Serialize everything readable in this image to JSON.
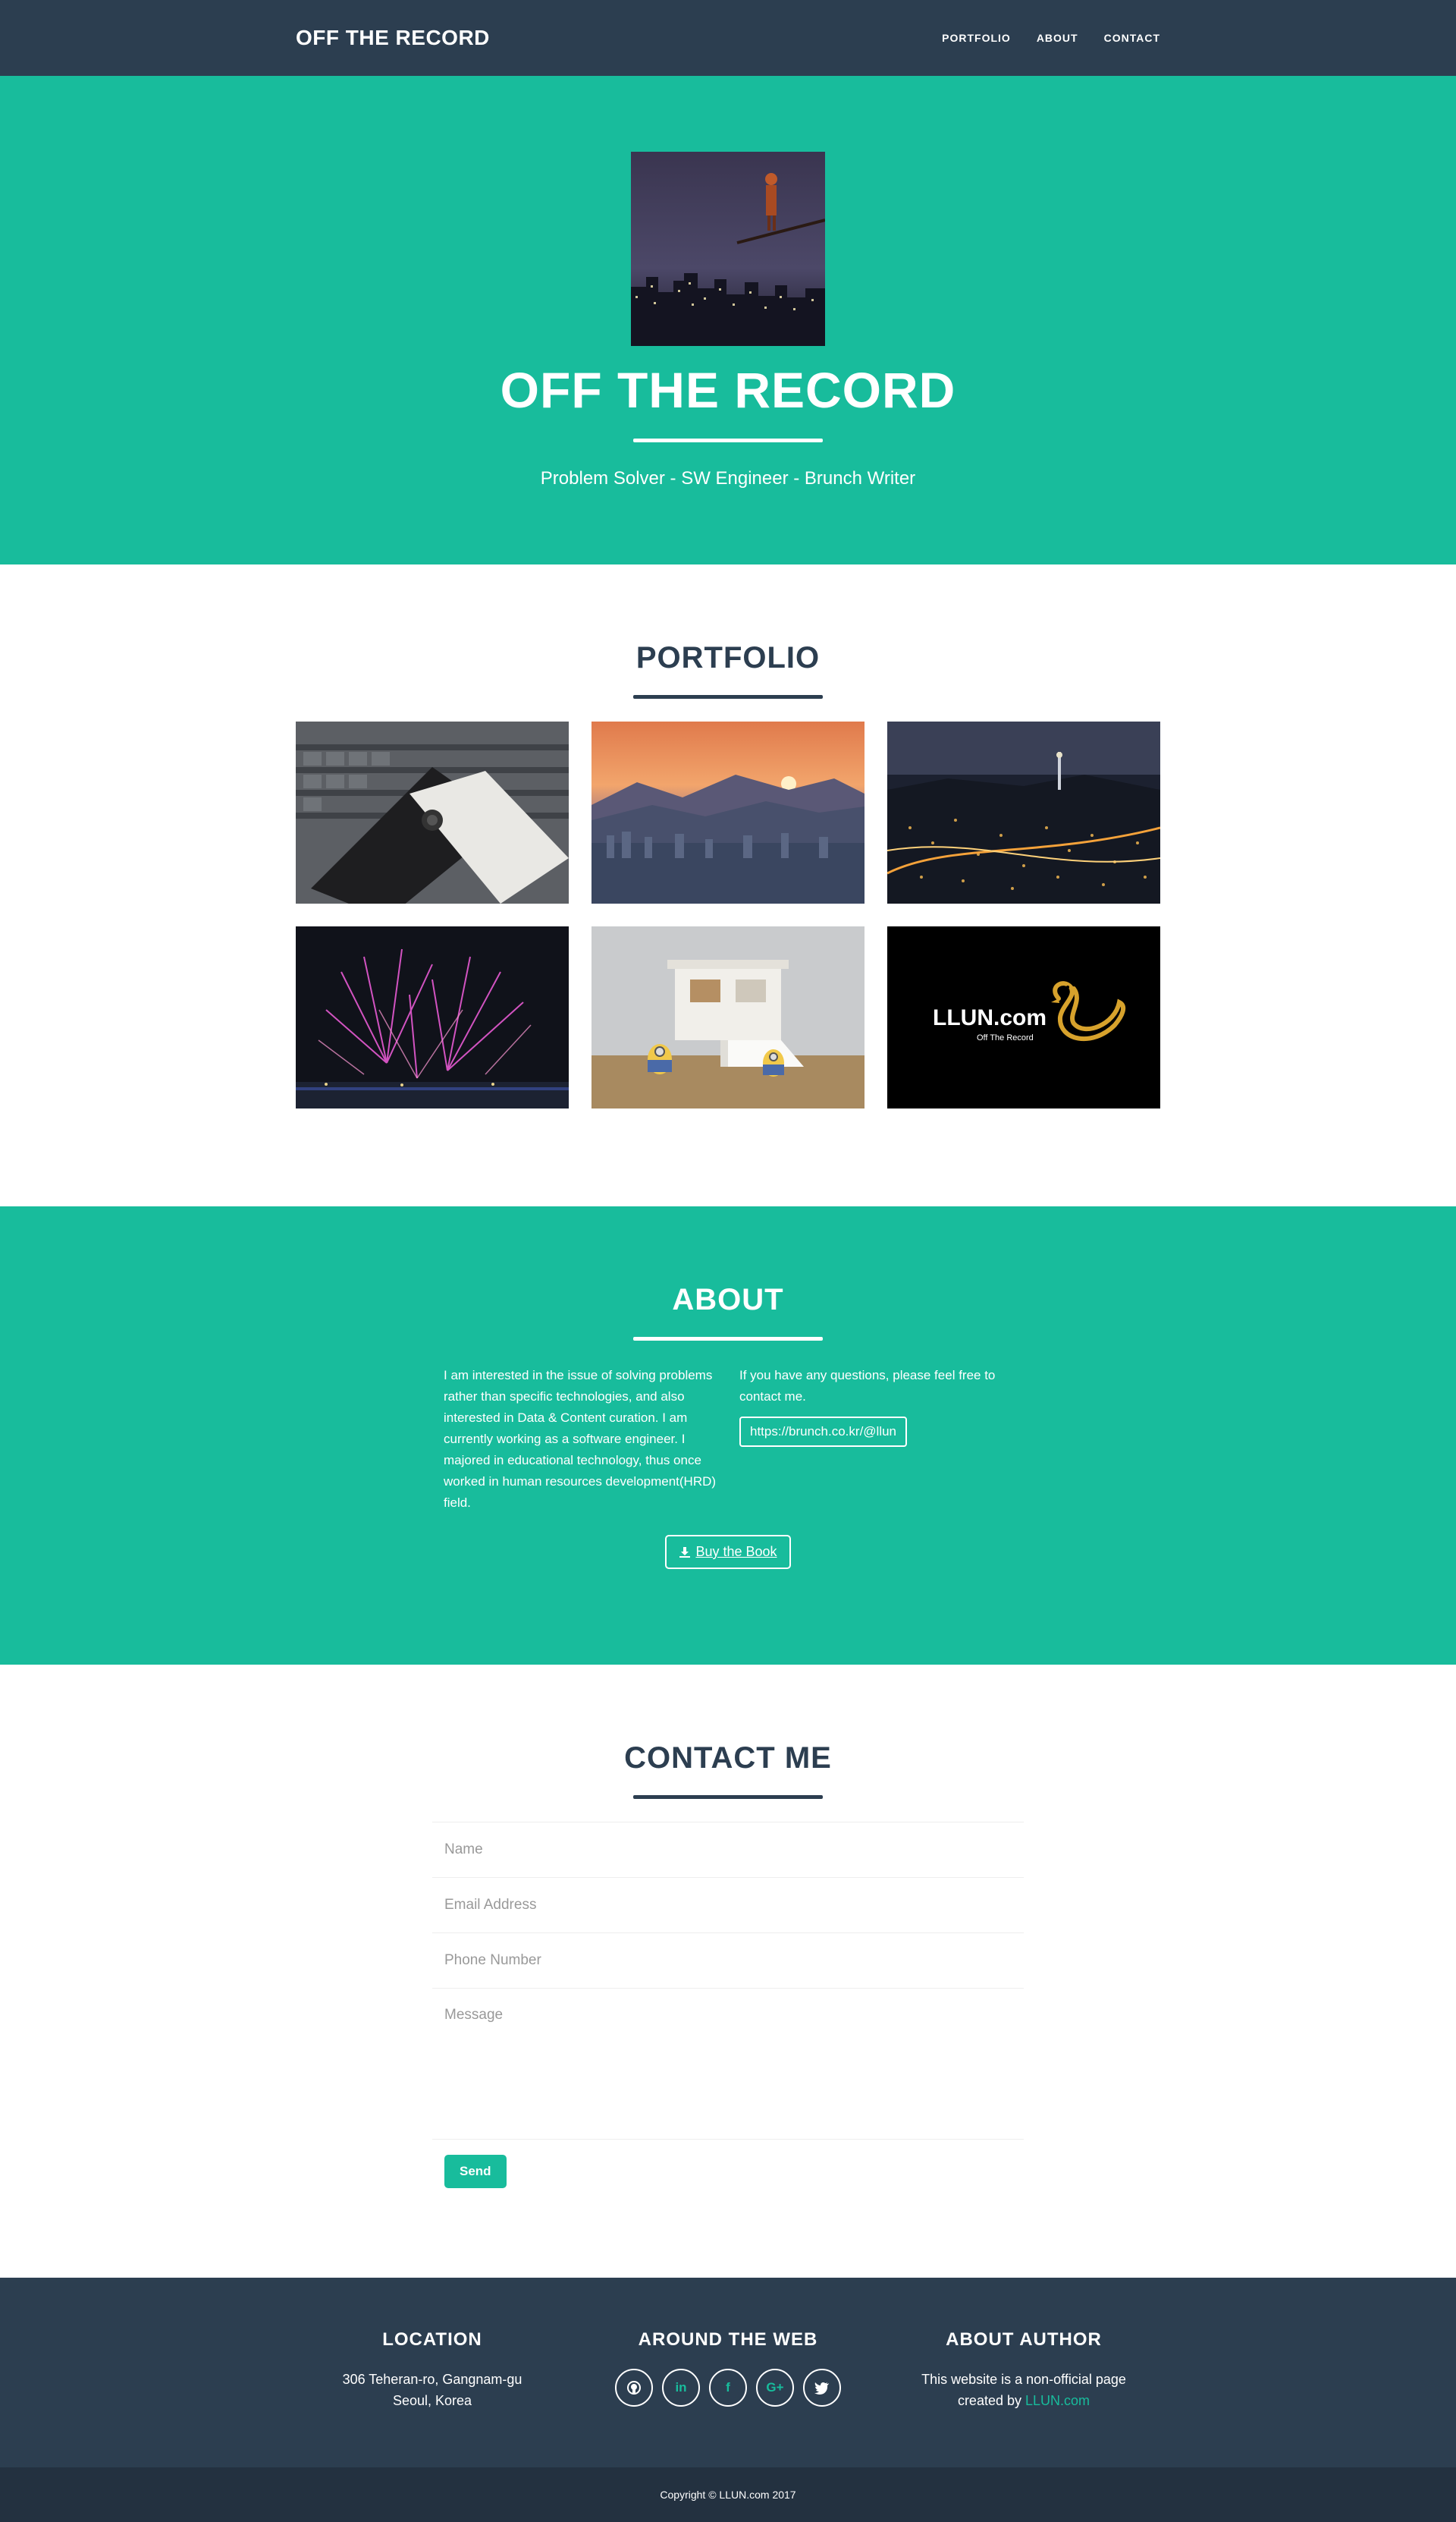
{
  "nav": {
    "brand": "OFF THE RECORD",
    "links": [
      "PORTFOLIO",
      "ABOUT",
      "CONTACT"
    ]
  },
  "hero": {
    "title": "OFF THE RECORD",
    "subtitle": "Problem Solver - SW Engineer - Brunch Writer"
  },
  "portfolio": {
    "title": "PORTFOLIO",
    "tiles": [
      {
        "icon": "smartphones-photo"
      },
      {
        "icon": "mountain-sunset-photo"
      },
      {
        "icon": "city-night-photo"
      },
      {
        "icon": "fireworks-photo"
      },
      {
        "icon": "model-house-photo"
      },
      {
        "icon": "llun-logo",
        "logo_text": "LLUN.com",
        "logo_sub": "Off The Record"
      }
    ]
  },
  "about": {
    "title": "ABOUT",
    "left_text": "I am interested in the issue of solving problems rather than specific technologies, and also interested in Data & Content curation. I am currently working as a software engineer. I majored in educational technology, thus once worked in human resources development(HRD) field.",
    "right_text": "If you have any questions, please feel free to contact me.",
    "link_label": "https://brunch.co.kr/@llun",
    "button_label": "Buy the Book"
  },
  "contact": {
    "title": "CONTACT ME",
    "placeholders": {
      "name": "Name",
      "email": "Email Address",
      "phone": "Phone Number",
      "message": "Message"
    },
    "send_label": "Send"
  },
  "footer": {
    "location_title": "LOCATION",
    "location_line1": "306 Teheran-ro, Gangnam-gu",
    "location_line2": "Seoul, Korea",
    "web_title": "AROUND THE WEB",
    "socials": [
      {
        "icon": "github-icon"
      },
      {
        "icon": "linkedin-icon",
        "text": "in"
      },
      {
        "icon": "facebook-icon",
        "text": "f"
      },
      {
        "icon": "google-plus-icon",
        "text": "G+"
      },
      {
        "icon": "twitter-icon"
      }
    ],
    "author_title": "ABOUT AUTHOR",
    "author_text": "This website is a non-official page",
    "author_created": "created by",
    "author_link": "LLUN.com",
    "copyright": "Copyright © LLUN.com 2017"
  },
  "colors": {
    "primary": "#2c3e50",
    "accent": "#18bc9c",
    "copyright_bg": "#233140"
  }
}
